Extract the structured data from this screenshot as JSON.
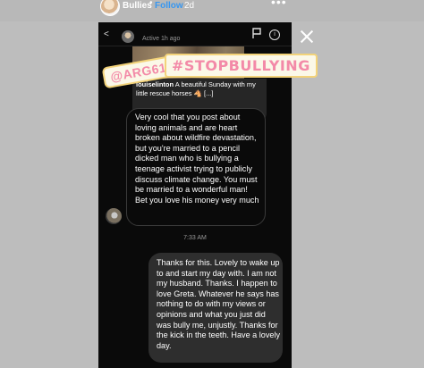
{
  "story": {
    "username": "Bullies",
    "separator": "•",
    "follow_label": "Follow",
    "time": "2d",
    "more": "•••",
    "close": "×"
  },
  "dm": {
    "back": "<",
    "active_status": "Active 1h ago",
    "info": "i"
  },
  "post_preview": {
    "username": "louiselinton",
    "caption": "A beautiful Sunday with my little rescue horses 🐴 [...]"
  },
  "stickers": {
    "mention": "@ARG613",
    "hashtag": "#STOPBULLYING"
  },
  "messages": {
    "incoming": "Very cool that you post about loving animals and are heart broken about wildfire devastation, but you're married to a pencil dicked man who is bullying a teenage activist trying to publicly discuss climate change. You must be married to a wonderful man! Bet you love his money very much",
    "timestamp": "7:33 AM",
    "outgoing": "Thanks for this. Lovely to wake up to and start my day with. I am not my husband. Thanks. I happen to love Greta. Whatever he says has nothing to do with my views or opinions and what you just did was bully me, unjustly. Thanks for the kick in the teeth. Have a lovely day."
  },
  "colors": {
    "follow": "#3897f0",
    "sticker_text": "#f38aa8",
    "sticker_border": "#f3d37a",
    "outgoing_bubble": "#2e2e2e"
  }
}
